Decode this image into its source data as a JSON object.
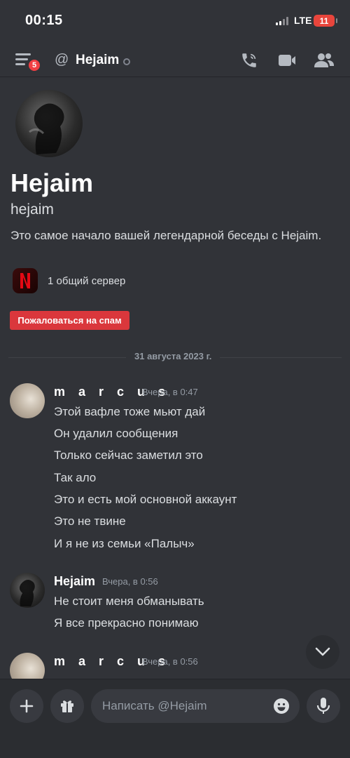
{
  "status_bar": {
    "time": "00:15",
    "network": "LTE",
    "battery": "11"
  },
  "header": {
    "notification_count": "5",
    "channel_name": "Hejaim"
  },
  "profile": {
    "display_name": "Hejaim",
    "username": "hejaim",
    "intro": "Это самое начало вашей легендарной беседы с Hejaim.",
    "mutual_servers": "1 общий сервер",
    "spam_button": "Пожаловаться на спам"
  },
  "date_divider": "31 августа 2023 г.",
  "messages": [
    {
      "author": "m a r c u s",
      "time": "Вчера, в 0:47",
      "lines": [
        "Этой вафле тоже мьют дай",
        "Он удалил сообщения",
        "Только сейчас заметил это",
        "Так ало",
        "Это и есть мой основной аккаунт",
        "Это не твине",
        "И я не из семьи «Палыч»"
      ]
    },
    {
      "author": "Hejaim",
      "time": "Вчера, в 0:56",
      "lines": [
        "Не стоит меня обманывать",
        "Я все прекрасно понимаю"
      ]
    },
    {
      "author": "m a r c u s",
      "time": "Вчера, в 0:56",
      "lines": []
    }
  ],
  "composer": {
    "placeholder": "Написать @Hejaim"
  },
  "icons": {
    "menu": "hamburger-menu-icon",
    "at": "at-sign-icon",
    "call": "phone-call-icon",
    "video": "video-camera-icon",
    "members": "members-icon",
    "plus": "plus-icon",
    "gift": "gift-icon",
    "emoji": "emoji-icon",
    "mic": "microphone-icon",
    "scroll": "chevron-down-icon"
  },
  "colors": {
    "background": "#313338",
    "danger": "#da373c",
    "text_muted": "#949ba4"
  }
}
